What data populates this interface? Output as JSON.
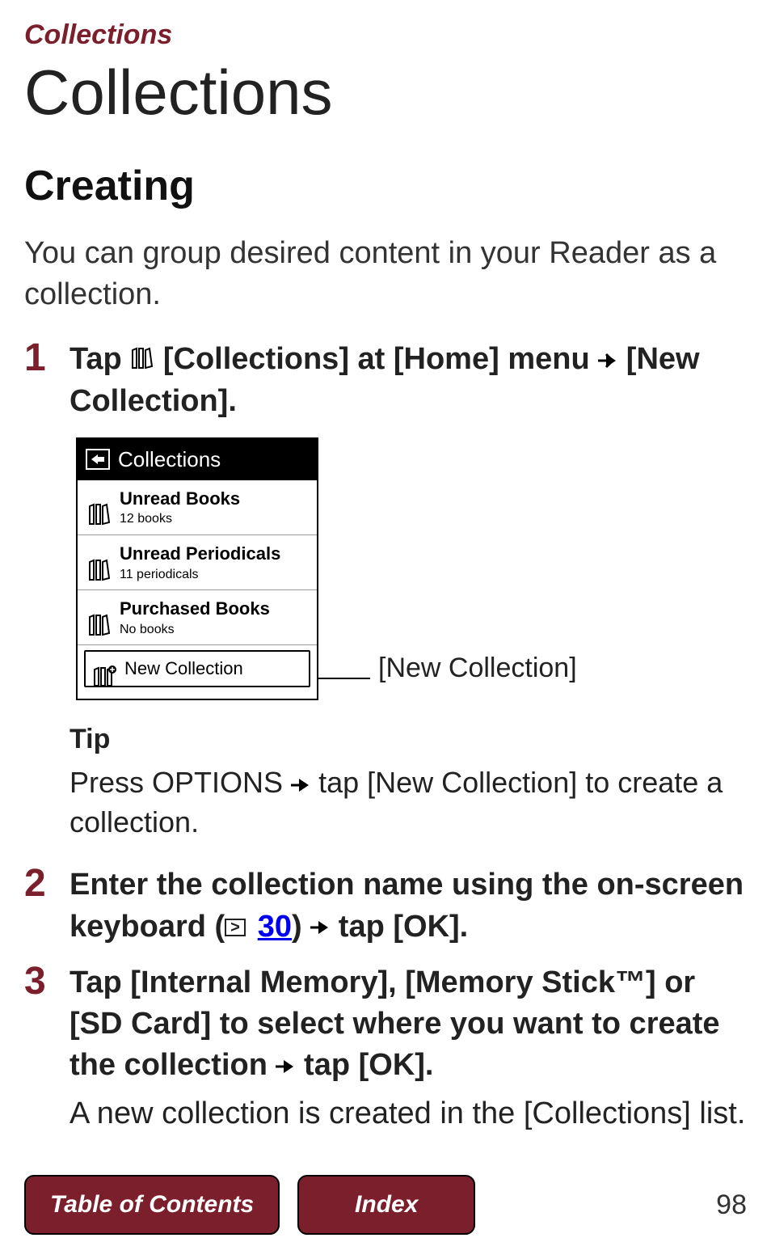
{
  "breadcrumb": "Collections",
  "title": "Collections",
  "section": "Creating",
  "intro": "You can group desired content in your Reader as a collection.",
  "steps": {
    "1": {
      "pre": "Tap ",
      "label_collections": " [Collections] at [Home] menu ",
      "post": " [New Collection]."
    },
    "2": {
      "pre": "Enter the collection name using the on-screen keyboard (",
      "page_ref": "30",
      "mid": ") ",
      "post": " tap [OK]."
    },
    "3": {
      "pre": "Tap [Internal Memory], [Memory Stick™] or [SD Card] to select where you want to create the collection ",
      "post": " tap [OK].",
      "result": "A new collection is created in the [Collections] list."
    }
  },
  "screenshot": {
    "header": "Collections",
    "rows": [
      {
        "title": "Unread Books",
        "sub": "12 books"
      },
      {
        "title": "Unread Periodicals",
        "sub": "11 periodicals"
      },
      {
        "title": "Purchased Books",
        "sub": "No books"
      }
    ],
    "new_label": "New Collection"
  },
  "callout": "[New Collection]",
  "tip": {
    "title": "Tip",
    "pre": "Press OPTIONS ",
    "post": " tap [New Collection] to create a collection."
  },
  "footer": {
    "toc": "Table of Contents",
    "index": "Index",
    "page": "98"
  }
}
